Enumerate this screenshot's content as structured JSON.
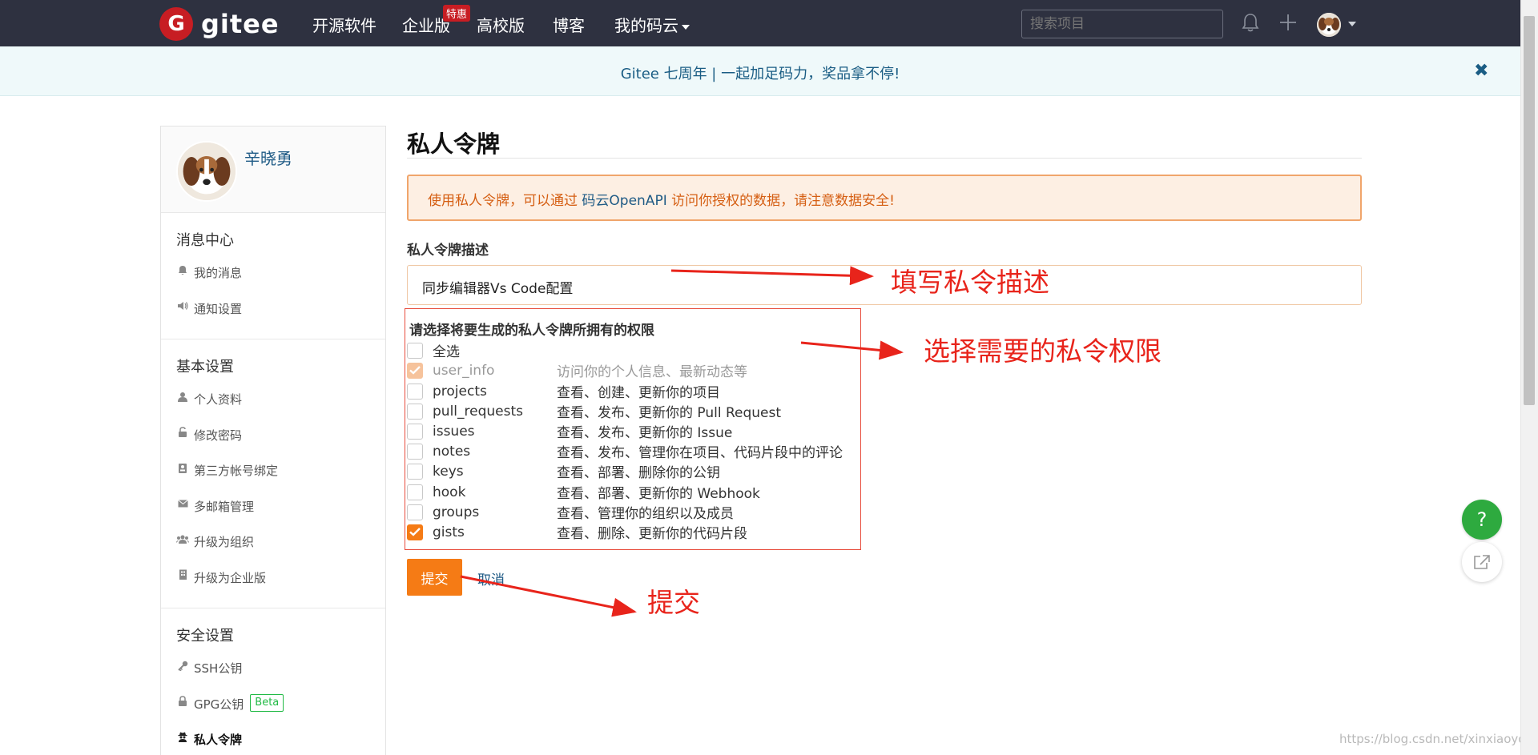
{
  "nav": {
    "logo_text": "gitee",
    "logo_letter": "G",
    "links": [
      "开源软件",
      "企业版",
      "高校版",
      "博客",
      "我的码云"
    ],
    "badge": "特惠",
    "search_placeholder": "搜索项目"
  },
  "banner": {
    "text": "Gitee 七周年 | 一起加足码力，奖品拿不停!",
    "close": "✖"
  },
  "sidebar": {
    "user_name": "辛晓勇",
    "sections": [
      {
        "title": "消息中心",
        "items": [
          {
            "label": "我的消息",
            "icon": "bell-icon"
          },
          {
            "label": "通知设置",
            "icon": "speaker-icon"
          }
        ]
      },
      {
        "title": "基本设置",
        "items": [
          {
            "label": "个人资料",
            "icon": "user-icon"
          },
          {
            "label": "修改密码",
            "icon": "unlock-icon"
          },
          {
            "label": "第三方帐号绑定",
            "icon": "id-card-icon"
          },
          {
            "label": "多邮箱管理",
            "icon": "mail-icon"
          },
          {
            "label": "升级为组织",
            "icon": "group-icon"
          },
          {
            "label": "升级为企业版",
            "icon": "building-icon"
          }
        ]
      },
      {
        "title": "安全设置",
        "items": [
          {
            "label": "SSH公钥",
            "icon": "key-icon"
          },
          {
            "label": "GPG公钥",
            "icon": "lock-icon",
            "badge": "Beta"
          },
          {
            "label": "私人令牌",
            "icon": "user-secret-icon",
            "active": true
          }
        ]
      }
    ]
  },
  "main": {
    "title": "私人令牌",
    "warning_pre": "使用私人令牌，可以通过 ",
    "warning_link": "码云OpenAPI",
    "warning_post": " 访问你授权的数据，请注意数据安全!",
    "desc_label": "私人令牌描述",
    "desc_value": "同步编辑器Vs Code配置",
    "perm_title": "请选择将要生成的私人令牌所拥有的权限",
    "permissions": [
      {
        "name": "全选",
        "desc": "",
        "checked": false
      },
      {
        "name": "user_info",
        "desc": "访问你的个人信息、最新动态等",
        "checked": true,
        "disabled": true
      },
      {
        "name": "projects",
        "desc": "查看、创建、更新你的项目",
        "checked": false
      },
      {
        "name": "pull_requests",
        "desc": "查看、发布、更新你的 Pull Request",
        "checked": false
      },
      {
        "name": "issues",
        "desc": "查看、发布、更新你的 Issue",
        "checked": false
      },
      {
        "name": "notes",
        "desc": "查看、发布、管理你在项目、代码片段中的评论",
        "checked": false
      },
      {
        "name": "keys",
        "desc": "查看、部署、删除你的公钥",
        "checked": false
      },
      {
        "name": "hook",
        "desc": "查看、部署、更新你的 Webhook",
        "checked": false
      },
      {
        "name": "groups",
        "desc": "查看、管理你的组织以及成员",
        "checked": false
      },
      {
        "name": "gists",
        "desc": "查看、删除、更新你的代码片段",
        "checked": true
      }
    ],
    "submit": "提交",
    "cancel": "取消"
  },
  "annotations": {
    "desc_note": "填写私令描述",
    "perm_note": "选择需要的私令权限",
    "submit_note": "提交"
  },
  "floating": {
    "help": "?"
  },
  "watermark": "https://blog.csdn.net/xinxiaoyong",
  "colors": {
    "nav_bg": "#2e3140",
    "accent": "#f57b15",
    "brand_red": "#c71d23",
    "annotation": "#e8241b",
    "help_green": "#2eaa3f"
  }
}
